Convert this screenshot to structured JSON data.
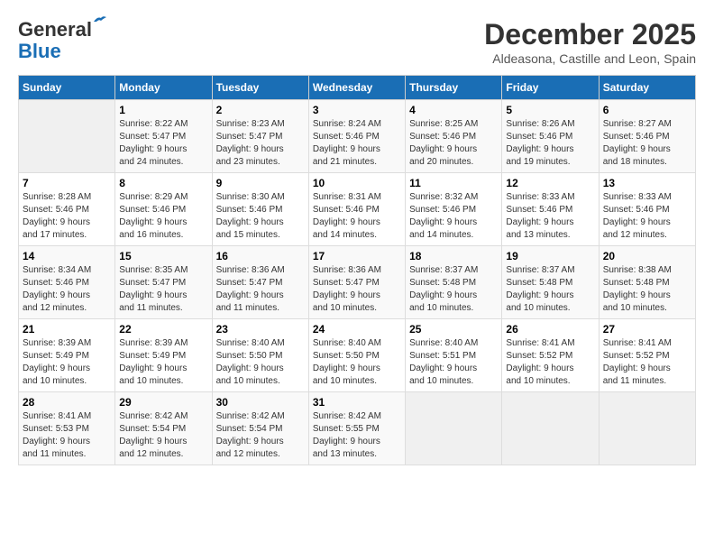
{
  "header": {
    "logo_line1": "General",
    "logo_line2": "Blue",
    "month_title": "December 2025",
    "subtitle": "Aldeasona, Castille and Leon, Spain"
  },
  "days_of_week": [
    "Sunday",
    "Monday",
    "Tuesday",
    "Wednesday",
    "Thursday",
    "Friday",
    "Saturday"
  ],
  "weeks": [
    [
      {
        "day": "",
        "info": ""
      },
      {
        "day": "1",
        "info": "Sunrise: 8:22 AM\nSunset: 5:47 PM\nDaylight: 9 hours\nand 24 minutes."
      },
      {
        "day": "2",
        "info": "Sunrise: 8:23 AM\nSunset: 5:47 PM\nDaylight: 9 hours\nand 23 minutes."
      },
      {
        "day": "3",
        "info": "Sunrise: 8:24 AM\nSunset: 5:46 PM\nDaylight: 9 hours\nand 21 minutes."
      },
      {
        "day": "4",
        "info": "Sunrise: 8:25 AM\nSunset: 5:46 PM\nDaylight: 9 hours\nand 20 minutes."
      },
      {
        "day": "5",
        "info": "Sunrise: 8:26 AM\nSunset: 5:46 PM\nDaylight: 9 hours\nand 19 minutes."
      },
      {
        "day": "6",
        "info": "Sunrise: 8:27 AM\nSunset: 5:46 PM\nDaylight: 9 hours\nand 18 minutes."
      }
    ],
    [
      {
        "day": "7",
        "info": "Sunrise: 8:28 AM\nSunset: 5:46 PM\nDaylight: 9 hours\nand 17 minutes."
      },
      {
        "day": "8",
        "info": "Sunrise: 8:29 AM\nSunset: 5:46 PM\nDaylight: 9 hours\nand 16 minutes."
      },
      {
        "day": "9",
        "info": "Sunrise: 8:30 AM\nSunset: 5:46 PM\nDaylight: 9 hours\nand 15 minutes."
      },
      {
        "day": "10",
        "info": "Sunrise: 8:31 AM\nSunset: 5:46 PM\nDaylight: 9 hours\nand 14 minutes."
      },
      {
        "day": "11",
        "info": "Sunrise: 8:32 AM\nSunset: 5:46 PM\nDaylight: 9 hours\nand 14 minutes."
      },
      {
        "day": "12",
        "info": "Sunrise: 8:33 AM\nSunset: 5:46 PM\nDaylight: 9 hours\nand 13 minutes."
      },
      {
        "day": "13",
        "info": "Sunrise: 8:33 AM\nSunset: 5:46 PM\nDaylight: 9 hours\nand 12 minutes."
      }
    ],
    [
      {
        "day": "14",
        "info": "Sunrise: 8:34 AM\nSunset: 5:46 PM\nDaylight: 9 hours\nand 12 minutes."
      },
      {
        "day": "15",
        "info": "Sunrise: 8:35 AM\nSunset: 5:47 PM\nDaylight: 9 hours\nand 11 minutes."
      },
      {
        "day": "16",
        "info": "Sunrise: 8:36 AM\nSunset: 5:47 PM\nDaylight: 9 hours\nand 11 minutes."
      },
      {
        "day": "17",
        "info": "Sunrise: 8:36 AM\nSunset: 5:47 PM\nDaylight: 9 hours\nand 10 minutes."
      },
      {
        "day": "18",
        "info": "Sunrise: 8:37 AM\nSunset: 5:48 PM\nDaylight: 9 hours\nand 10 minutes."
      },
      {
        "day": "19",
        "info": "Sunrise: 8:37 AM\nSunset: 5:48 PM\nDaylight: 9 hours\nand 10 minutes."
      },
      {
        "day": "20",
        "info": "Sunrise: 8:38 AM\nSunset: 5:48 PM\nDaylight: 9 hours\nand 10 minutes."
      }
    ],
    [
      {
        "day": "21",
        "info": "Sunrise: 8:39 AM\nSunset: 5:49 PM\nDaylight: 9 hours\nand 10 minutes."
      },
      {
        "day": "22",
        "info": "Sunrise: 8:39 AM\nSunset: 5:49 PM\nDaylight: 9 hours\nand 10 minutes."
      },
      {
        "day": "23",
        "info": "Sunrise: 8:40 AM\nSunset: 5:50 PM\nDaylight: 9 hours\nand 10 minutes."
      },
      {
        "day": "24",
        "info": "Sunrise: 8:40 AM\nSunset: 5:50 PM\nDaylight: 9 hours\nand 10 minutes."
      },
      {
        "day": "25",
        "info": "Sunrise: 8:40 AM\nSunset: 5:51 PM\nDaylight: 9 hours\nand 10 minutes."
      },
      {
        "day": "26",
        "info": "Sunrise: 8:41 AM\nSunset: 5:52 PM\nDaylight: 9 hours\nand 10 minutes."
      },
      {
        "day": "27",
        "info": "Sunrise: 8:41 AM\nSunset: 5:52 PM\nDaylight: 9 hours\nand 11 minutes."
      }
    ],
    [
      {
        "day": "28",
        "info": "Sunrise: 8:41 AM\nSunset: 5:53 PM\nDaylight: 9 hours\nand 11 minutes."
      },
      {
        "day": "29",
        "info": "Sunrise: 8:42 AM\nSunset: 5:54 PM\nDaylight: 9 hours\nand 12 minutes."
      },
      {
        "day": "30",
        "info": "Sunrise: 8:42 AM\nSunset: 5:54 PM\nDaylight: 9 hours\nand 12 minutes."
      },
      {
        "day": "31",
        "info": "Sunrise: 8:42 AM\nSunset: 5:55 PM\nDaylight: 9 hours\nand 13 minutes."
      },
      {
        "day": "",
        "info": ""
      },
      {
        "day": "",
        "info": ""
      },
      {
        "day": "",
        "info": ""
      }
    ]
  ]
}
